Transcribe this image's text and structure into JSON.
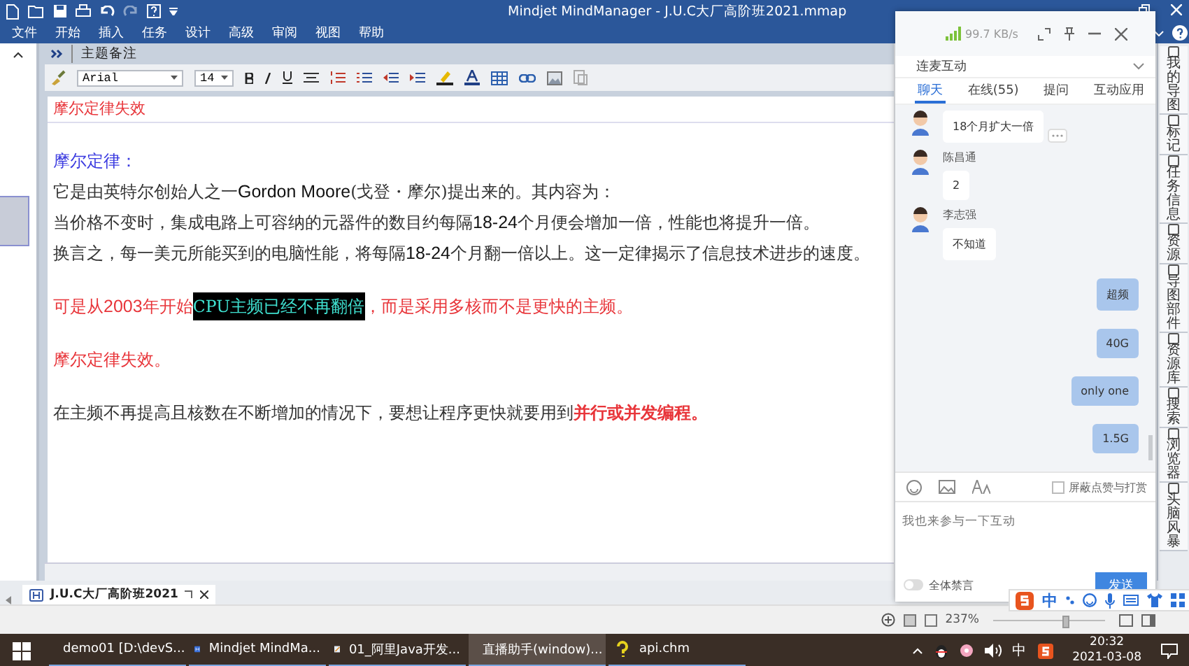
{
  "window": {
    "title": "Mindjet MindManager - J.U.C大厂高阶班2021.mmap"
  },
  "menu": [
    "文件",
    "开始",
    "插入",
    "任务",
    "设计",
    "高级",
    "审阅",
    "视图",
    "帮助"
  ],
  "notes": {
    "header": "主题备注",
    "font": "Arial",
    "size": "14",
    "title": "摩尔定律失效",
    "blocks": [
      [
        [
          {
            "kind": "heading",
            "text": "摩尔定律："
          }
        ],
        [
          {
            "kind": "text",
            "text": "它是由英特尔创始人之一"
          },
          {
            "kind": "latin",
            "text": "Gordon Moore"
          },
          {
            "kind": "text",
            "text": "(戈登・摩尔)提出来的。其内容为："
          }
        ],
        [
          {
            "kind": "text",
            "text": "当价格不变时，集成电路上可容纳的元器件的数目约每隔"
          },
          {
            "kind": "latin",
            "text": "18-24"
          },
          {
            "kind": "text",
            "text": "个月便会增加一倍，性能也将提升一倍。"
          }
        ],
        [
          {
            "kind": "text",
            "text": "换言之，每一美元所能买到的电脑性能，将每隔"
          },
          {
            "kind": "latin",
            "text": "18-24"
          },
          {
            "kind": "text",
            "text": "个月翻一倍以上。这一定律揭示了信息技术进步的速度。"
          }
        ]
      ],
      [
        [
          {
            "kind": "red",
            "text": "可是从"
          },
          {
            "kind": "red-latin",
            "text": "2003"
          },
          {
            "kind": "red",
            "text": "年开始"
          },
          {
            "kind": "highlight",
            "text": "CPU主频已经不再翻倍"
          },
          {
            "kind": "red",
            "text": "，而是采用多核而不是更快的主频。"
          }
        ]
      ],
      [
        [
          {
            "kind": "red",
            "text": "摩尔定律失效。"
          }
        ]
      ],
      [
        [
          {
            "kind": "text",
            "text": "在主频不再提高且核数在不断增加的情况下，要想让程序更快就要用到"
          },
          {
            "kind": "red-bold",
            "text": "并行或并发编程。"
          }
        ]
      ]
    ]
  },
  "side_panels": [
    "我的导图",
    "标记",
    "任务信息",
    "资源",
    "导图部件",
    "资源库",
    "搜索",
    "浏览器",
    "头脑风暴"
  ],
  "chat": {
    "speed": "99.7 KB/s",
    "channel": "连麦互动",
    "tabs": [
      {
        "label": "聊天",
        "selected": true
      },
      {
        "label": "在线(55)",
        "selected": false
      },
      {
        "label": "提问",
        "selected": false
      },
      {
        "label": "互动应用",
        "selected": false
      }
    ],
    "messages": [
      {
        "mine": false,
        "text": "18个月扩大一倍",
        "more_button": true
      },
      {
        "mine": false,
        "sender": "陈昌通",
        "text": "2",
        "more_button": false
      },
      {
        "mine": false,
        "sender": "李志强",
        "text": "不知道",
        "more_button": false
      },
      {
        "mine": true,
        "text": "超频",
        "more_button": false
      },
      {
        "mine": true,
        "text": "40G",
        "more_button": false
      },
      {
        "mine": true,
        "text": "only one",
        "more_button": false
      },
      {
        "mine": true,
        "text": "1.5G",
        "more_button": false
      }
    ],
    "block_option": {
      "label": "屏蔽点赞与打赏",
      "checked": false
    },
    "input": {
      "placeholder": "我也来参与一下互动"
    },
    "mute_all": {
      "label": "全体禁言",
      "on": false
    },
    "send": "发送"
  },
  "document_tab": {
    "label": "J.U.C大厂高阶班2021"
  },
  "status_bar": {
    "zoom": "237%",
    "zoom_slider": {
      "level": 0.65
    }
  },
  "ime_bar": {
    "mode": "中"
  },
  "taskbar": {
    "apps": [
      {
        "kind": "ide",
        "label": "demo01 [D:\\devS...",
        "selected": false
      },
      {
        "kind": "mindmap",
        "label": "Mindjet MindMa...",
        "selected": false
      },
      {
        "kind": "document",
        "label": "01_阿里Java开发...",
        "selected": false
      },
      {
        "kind": "stream",
        "label": "直播助手(window)...",
        "selected": true
      },
      {
        "kind": "help",
        "label": "api.chm",
        "selected": false
      }
    ],
    "ime": "中",
    "time": "20:32",
    "date": "2021-03-08"
  }
}
